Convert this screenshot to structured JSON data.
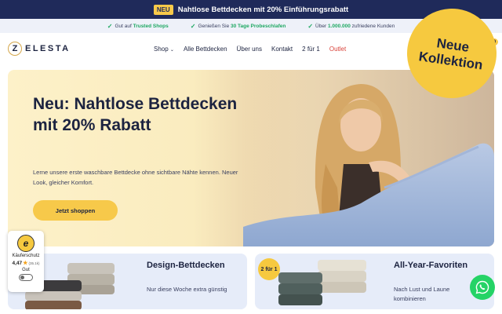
{
  "announcement": {
    "badge": "NEU",
    "text": "Nahtlose Bettdecken mit 20% Einführungsrabatt"
  },
  "usps": [
    {
      "prefix": "Gut auf ",
      "highlight": "Trusted Shops",
      "suffix": ""
    },
    {
      "prefix": "Genießen Sie ",
      "highlight": "30 Tage Probeschlafen",
      "suffix": ""
    },
    {
      "prefix": "Über ",
      "highlight": "1.000.000",
      "suffix": " zufriedene Kunden"
    }
  ],
  "header": {
    "logo_letter": "Z",
    "logo_text": "ELESTA",
    "nav": [
      "Shop",
      "Alle Bettdecken",
      "Über uns",
      "Kontakt",
      "2 für 1",
      "Outlet"
    ],
    "nav_chevron": "⌄",
    "cart_count": "0"
  },
  "hero": {
    "title": "Neu: Nahtlose Bettdecken mit 20% Rabatt",
    "text": "Lerne unsere erste waschbare Bettdecke ohne sichtbare Nähte kennen. Neuer Look, gleicher Komfort.",
    "cta": "Jetzt shoppen",
    "ribbon_line1": "Neue",
    "ribbon_line2": "Kollektion"
  },
  "cards": [
    {
      "title": "Design-Bettdecken",
      "sub": "Nur diese Woche extra günstig"
    },
    {
      "badge": "2 für 1",
      "title": "All-Year-Favoriten",
      "sub": "Nach Lust und Laune kombinieren"
    }
  ],
  "trust_widget": {
    "seal": "e",
    "label": "Käuferschutz",
    "score": "4,47",
    "count": "(35.1k)",
    "rating": "Gut"
  },
  "colors": {
    "brand_navy": "#1f2a5a",
    "accent_yellow": "#f7c94a",
    "success_green": "#1ea862",
    "outlet_red": "#d9423a",
    "whatsapp": "#25d366"
  }
}
